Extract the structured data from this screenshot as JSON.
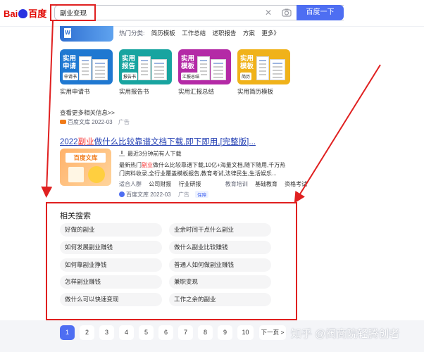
{
  "header": {
    "logo_bai": "Bai",
    "logo_du": "百度",
    "search_value": "副业变现",
    "search_button": "百度一下",
    "clear_glyph": "✕"
  },
  "top_row": {
    "hot_label": "热门分类:",
    "items": [
      "简历模板",
      "工作总结",
      "述职报告",
      "方案",
      "更多》"
    ]
  },
  "tiles": [
    {
      "tag": "实用申请",
      "badge": "申请书",
      "label": "实用申请书",
      "color": "#1f78d1"
    },
    {
      "tag": "实用报告",
      "badge": "报告书",
      "label": "实用报告书",
      "color": "#18a4a0"
    },
    {
      "tag": "实用模板",
      "badge": "汇报总结",
      "label": "实用汇报总结",
      "color": "#b42aa6"
    },
    {
      "tag": "实用模板",
      "badge": "简历",
      "label": "实用简历模板",
      "color": "#f0b21a"
    }
  ],
  "result1": {
    "more_link": "查看更多相关信息>>",
    "source": "百度文库",
    "date": "2022-03",
    "ad": "广告"
  },
  "result2": {
    "title_pre": "2022",
    "title_red": "副业",
    "title_post": "做什么比较靠谱文档下载,即下即用,[完整版]...",
    "image_tag": "百度文库",
    "download_line": "最近3分钟前有人下载",
    "abstract_pre": "最新热门",
    "abstract_red": "副业",
    "abstract_post": "做什么比较靠谱下载,10亿+海量文档,随下随用,千万热门资料收录,全行业覆盖模板报告,教育考试,法律民生,生活娱乐...",
    "tags": [
      "适合人群",
      "公司财报",
      "行业研报",
      "教育培训",
      "基础教育",
      "资格考试"
    ],
    "source": "百度文库",
    "date": "2022-03",
    "ad": "广告",
    "auth": "保障"
  },
  "related": {
    "title": "相关搜索",
    "items": [
      "好做的副业",
      "业余时间干点什么副业",
      "如何发展副业赚钱",
      "做什么副业比较赚钱",
      "如何靠副业挣钱",
      "普通人如何做副业赚钱",
      "怎样副业赚钱",
      "兼职变现",
      "做什么可以快速变现",
      "工作之余的副业"
    ]
  },
  "pagination": {
    "pages": [
      "1",
      "2",
      "3",
      "4",
      "5",
      "6",
      "7",
      "8",
      "9",
      "10"
    ],
    "active": "1",
    "next": "下一页 >"
  },
  "watermark": "知乎 @阀商院轻腾创者",
  "colors": {
    "accent": "#4e6ef2",
    "highlight": "#e02020",
    "link": "#2440b3",
    "keyword": "#f73131"
  }
}
